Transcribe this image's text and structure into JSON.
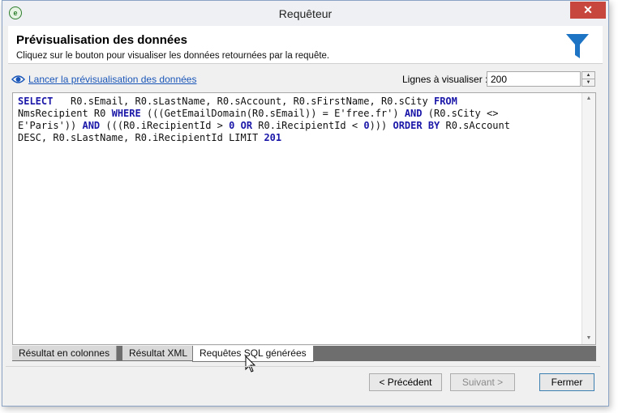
{
  "window": {
    "title": "Requêteur",
    "close_glyph": "✕"
  },
  "header": {
    "title": "Prévisualisation des données",
    "subtitle": "Cliquez sur le bouton pour visualiser les données retournées par la requête.",
    "icon": "funnel-icon"
  },
  "preview": {
    "link_label": "Lancer la prévisualisation des données",
    "lines_label": "Lignes à visualiser :",
    "lines_value": "200"
  },
  "sql": {
    "tokens": [
      {
        "t": "SELECT",
        "kw": true
      },
      {
        "t": "   R0.sEmail, R0.sLastName, R0.sAccount, R0.sFirstName, R0.sCity ",
        "kw": false
      },
      {
        "t": "FROM",
        "kw": true
      },
      {
        "t": "\nNmsRecipient R0 ",
        "kw": false
      },
      {
        "t": "WHERE",
        "kw": true
      },
      {
        "t": " (((GetEmailDomain(R0.sEmail)) = E'free.fr') ",
        "kw": false
      },
      {
        "t": "AND",
        "kw": true
      },
      {
        "t": " (R0.sCity <>\nE'Paris')) ",
        "kw": false
      },
      {
        "t": "AND",
        "kw": true
      },
      {
        "t": " (((R0.iRecipientId > ",
        "kw": false
      },
      {
        "t": "0",
        "kw": true
      },
      {
        "t": " ",
        "kw": false
      },
      {
        "t": "OR",
        "kw": true
      },
      {
        "t": " R0.iRecipientId < ",
        "kw": false
      },
      {
        "t": "0",
        "kw": true
      },
      {
        "t": "))) ",
        "kw": false
      },
      {
        "t": "ORDER BY",
        "kw": true
      },
      {
        "t": " R0.sAccount\nDESC, R0.sLastName, R0.iRecipientId LIMIT ",
        "kw": false
      },
      {
        "t": "201",
        "kw": true
      }
    ]
  },
  "tabs": [
    {
      "label": "Résultat en colonnes",
      "active": false
    },
    {
      "label": "Résultat XML",
      "active": false
    },
    {
      "label": "Requêtes SQL générées",
      "active": true
    }
  ],
  "buttons": {
    "previous": "< Précédent",
    "next": "Suivant >",
    "close": "Fermer"
  }
}
